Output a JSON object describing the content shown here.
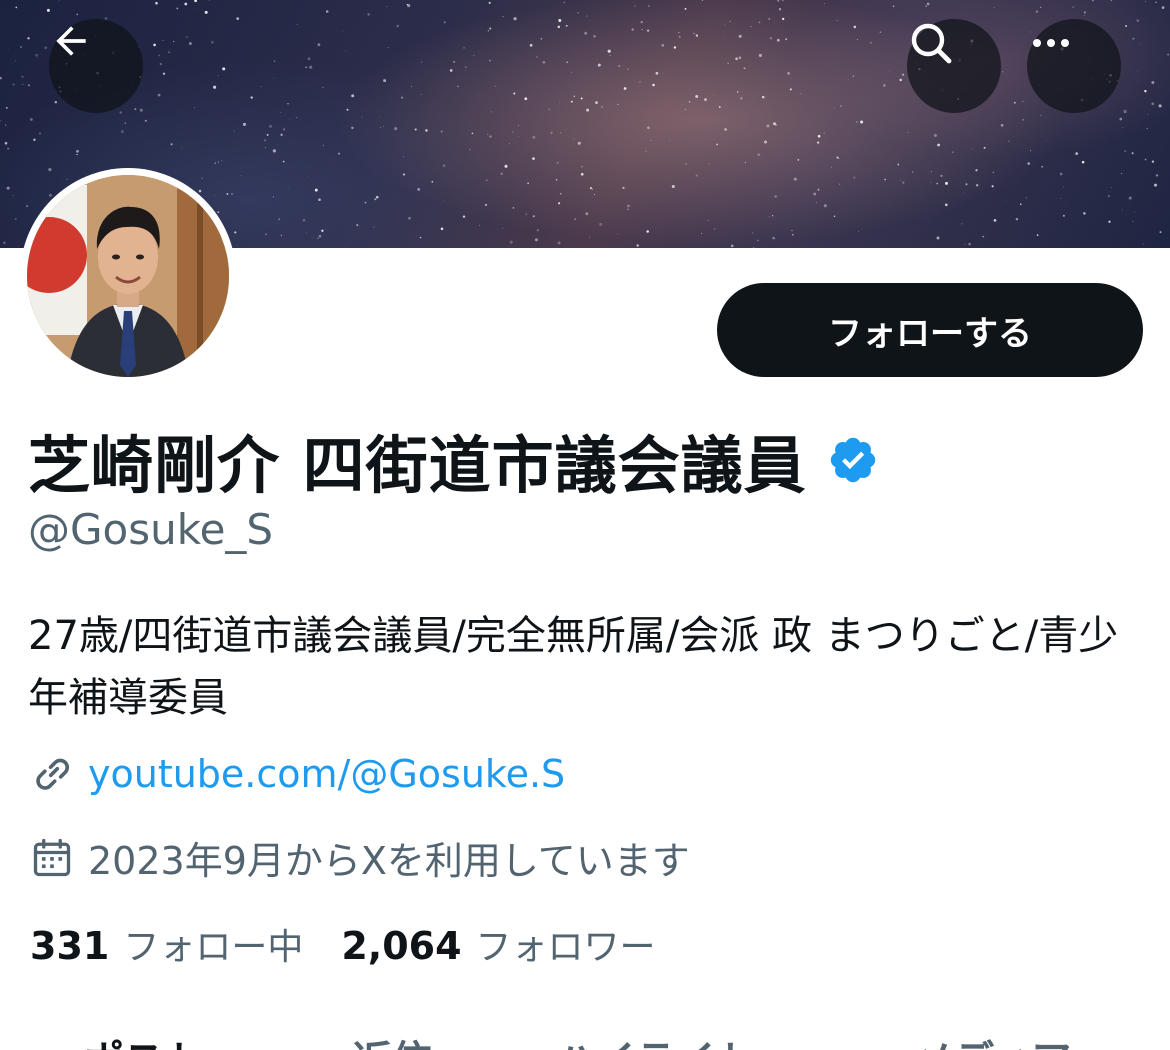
{
  "header": {
    "back_icon": "arrow-left-icon",
    "search_icon": "search-icon",
    "more_icon": "more-horizontal-icon"
  },
  "profile": {
    "display_name": "芝崎剛介 四街道市議会議員",
    "verified_icon": "verified-badge-icon",
    "handle": "@Gosuke_S",
    "follow_label": "フォローする",
    "bio": "27歳/四街道市議会議員/完全無所属/会派 政 まつりごと/青少年補導委員",
    "link_icon": "link-icon",
    "link_text": "youtube.com/@Gosuke.S",
    "join_icon": "calendar-icon",
    "join_text": "2023年9月からXを利用しています",
    "following_count": "331",
    "following_label": "フォロー中",
    "followers_count": "2,064",
    "followers_label": "フォロワー"
  },
  "tabs": [
    {
      "label": "ポスト"
    },
    {
      "label": "返信"
    },
    {
      "label": "ハイライト"
    },
    {
      "label": "メディア"
    }
  ],
  "colors": {
    "primary_text": "#0f1419",
    "secondary_text": "#536471",
    "link": "#1d9bf0",
    "verified": "#1d9bf0",
    "follow_button_bg": "#0f1419"
  }
}
